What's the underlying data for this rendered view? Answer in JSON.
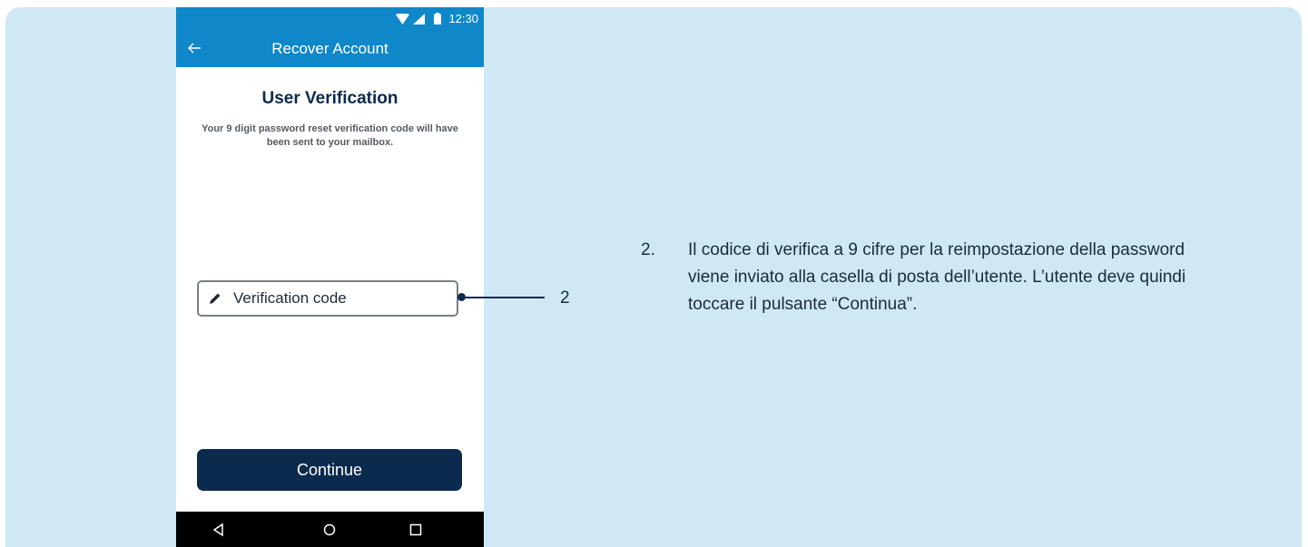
{
  "status_bar": {
    "time": "12:30"
  },
  "app_bar": {
    "title": "Recover Account"
  },
  "content": {
    "title": "User Verification",
    "description": "Your 9 digit password reset verification code will have been sent to your mailbox."
  },
  "field": {
    "label": "Verification code"
  },
  "continue_button": {
    "label": "Continue"
  },
  "callout": {
    "number": "2"
  },
  "step": {
    "number": "2.",
    "text": "Il codice di verifica a 9 cifre per la reimpostazione della password viene inviato alla casella di posta dell’utente. L’utente deve quindi toccare il pulsante “Continua”."
  },
  "colors": {
    "panel_background": "#cfe8f4",
    "app_bar": "#0f87c9",
    "primary_dark": "#0b2a4e"
  },
  "icons": [
    "wifi-icon",
    "signal-icon",
    "battery-icon",
    "back-arrow-icon",
    "pencil-icon",
    "nav-back-icon",
    "nav-home-icon",
    "nav-recents-icon"
  ]
}
